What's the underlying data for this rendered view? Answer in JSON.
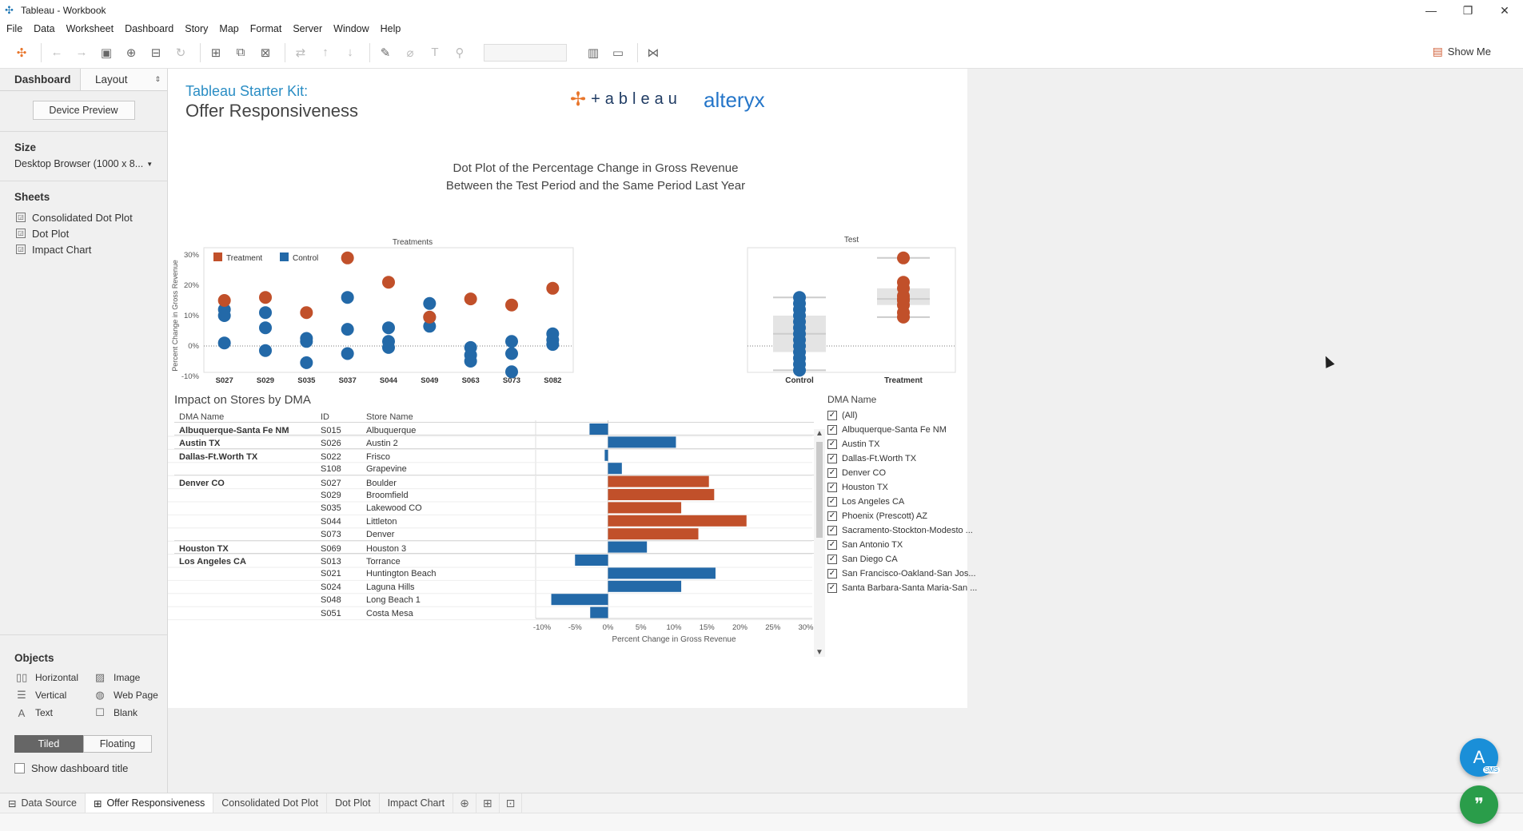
{
  "window": {
    "title": "Tableau - Workbook",
    "controls": [
      "—",
      "❐",
      "✕"
    ]
  },
  "menu": [
    "File",
    "Data",
    "Worksheet",
    "Dashboard",
    "Story",
    "Map",
    "Format",
    "Server",
    "Window",
    "Help"
  ],
  "toolbar": {
    "show_me": "Show Me"
  },
  "left_pane": {
    "tab_dashboard": "Dashboard",
    "tab_layout": "Layout",
    "device_preview": "Device Preview",
    "size_title": "Size",
    "size_value": "Desktop Browser (1000 x 8...",
    "sheets_title": "Sheets",
    "sheets": [
      "Consolidated Dot Plot",
      "Dot Plot",
      "Impact Chart"
    ],
    "objects_title": "Objects",
    "objects": [
      "Horizontal",
      "Image",
      "Vertical",
      "Web Page",
      "Text",
      "Blank"
    ],
    "tiled": "Tiled",
    "floating": "Floating",
    "show_title": "Show dashboard title"
  },
  "dashboard": {
    "kit_title": "Tableau Starter Kit:",
    "kit_subtitle": "Offer Responsiveness",
    "logo_tableau": "+ableau",
    "logo_alteryx": "alteryx",
    "chart_title_1": "Dot Plot of the Percentage Change in Gross Revenue",
    "chart_title_2": "Between the Test Period and the Same Period Last Year",
    "impact_title": "Impact on Stores by DMA"
  },
  "colors": {
    "treatment": "#c1502a",
    "control": "#2369a8",
    "accent_blue": "#2a8dc4"
  },
  "chart_data": [
    {
      "type": "scatter",
      "title": "Treatments",
      "ylabel": "Percent Change in Gross Revenue",
      "ylim": [
        -10,
        30
      ],
      "yticks": [
        "30%",
        "20%",
        "10%",
        "0%",
        "-10%"
      ],
      "categories": [
        "S027",
        "S029",
        "S035",
        "S037",
        "S044",
        "S049",
        "S063",
        "S073",
        "S082"
      ],
      "legend": [
        "Treatment",
        "Control"
      ],
      "series": [
        {
          "name": "Treatment",
          "values": [
            [
              15
            ],
            [
              16
            ],
            [
              11
            ],
            [
              29
            ],
            [
              21
            ],
            [
              9.5
            ],
            [
              15.5
            ],
            [
              13.5
            ],
            [
              19
            ]
          ]
        },
        {
          "name": "Control",
          "values": [
            [
              12,
              10,
              1
            ],
            [
              11,
              6,
              -1.5
            ],
            [
              2.5,
              1.5,
              -5.5
            ],
            [
              16,
              5.5,
              -2.5
            ],
            [
              6,
              1.5,
              -0.5
            ],
            [
              14,
              9.5,
              6.5
            ],
            [
              -0.5,
              -3,
              -5
            ],
            [
              1.5,
              -2.5,
              -8.5
            ],
            [
              4,
              2,
              0.5
            ]
          ]
        }
      ]
    },
    {
      "type": "scatter",
      "title": "Test",
      "ylim": [
        -10,
        30
      ],
      "categories": [
        "Control",
        "Treatment"
      ],
      "series": [
        {
          "name": "Control",
          "values": [
            16,
            14,
            12,
            10,
            8,
            6,
            4,
            2,
            0,
            -2,
            -4,
            -6,
            -8
          ]
        },
        {
          "name": "Treatment",
          "values": [
            29,
            21,
            19,
            16.5,
            15.5,
            15,
            13.5,
            11,
            9.5
          ]
        }
      ]
    },
    {
      "type": "bar",
      "title": "Impact on Stores by DMA",
      "xlabel": "Percent Change in Gross Revenue",
      "xlim": [
        -10,
        30
      ],
      "xticks": [
        "-10%",
        "-5%",
        "0%",
        "5%",
        "10%",
        "15%",
        "20%",
        "25%",
        "30%"
      ],
      "columns": [
        "DMA Name",
        "ID",
        "Store Name"
      ],
      "rows": [
        {
          "dma": "Albuquerque-Santa Fe NM",
          "id": "S015",
          "store": "Albuquerque",
          "value": -2.8,
          "group": "control"
        },
        {
          "dma": "Austin TX",
          "id": "S026",
          "store": "Austin 2",
          "value": 10.3,
          "group": "control"
        },
        {
          "dma": "Dallas-Ft.Worth TX",
          "id": "S022",
          "store": "Frisco",
          "value": -0.5,
          "group": "control"
        },
        {
          "dma": "",
          "id": "S108",
          "store": "Grapevine",
          "value": 2.1,
          "group": "control"
        },
        {
          "dma": "Denver CO",
          "id": "S027",
          "store": "Boulder",
          "value": 15.3,
          "group": "treatment"
        },
        {
          "dma": "",
          "id": "S029",
          "store": "Broomfield",
          "value": 16.1,
          "group": "treatment"
        },
        {
          "dma": "",
          "id": "S035",
          "store": "Lakewood CO",
          "value": 11.1,
          "group": "treatment"
        },
        {
          "dma": "",
          "id": "S044",
          "store": "Littleton",
          "value": 21.0,
          "group": "treatment"
        },
        {
          "dma": "",
          "id": "S073",
          "store": "Denver",
          "value": 13.7,
          "group": "treatment"
        },
        {
          "dma": "Houston TX",
          "id": "S069",
          "store": "Houston 3",
          "value": 5.9,
          "group": "control"
        },
        {
          "dma": "Los Angeles CA",
          "id": "S013",
          "store": "Torrance",
          "value": -5.0,
          "group": "control"
        },
        {
          "dma": "",
          "id": "S021",
          "store": "Huntington Beach",
          "value": 16.3,
          "group": "control"
        },
        {
          "dma": "",
          "id": "S024",
          "store": "Laguna Hills",
          "value": 11.1,
          "group": "control"
        },
        {
          "dma": "",
          "id": "S048",
          "store": "Long Beach 1",
          "value": -8.6,
          "group": "control"
        },
        {
          "dma": "",
          "id": "S051",
          "store": "Costa Mesa",
          "value": -2.7,
          "group": "control"
        }
      ]
    }
  ],
  "filter": {
    "title": "DMA Name",
    "items": [
      "(All)",
      "Albuquerque-Santa Fe NM",
      "Austin TX",
      "Dallas-Ft.Worth TX",
      "Denver CO",
      "Houston TX",
      "Los Angeles CA",
      "Phoenix (Prescott) AZ",
      "Sacramento-Stockton-Modesto ...",
      "San Antonio TX",
      "San Diego CA",
      "San Francisco-Oakland-San Jos...",
      "Santa Barbara-Santa Maria-San ..."
    ]
  },
  "bottom_tabs": {
    "data_source": "Data Source",
    "active": "Offer Responsiveness",
    "others": [
      "Consolidated Dot Plot",
      "Dot Plot",
      "Impact Chart"
    ]
  },
  "fab": {
    "a": "A",
    "sms": "SMS",
    "quote": "❞"
  }
}
